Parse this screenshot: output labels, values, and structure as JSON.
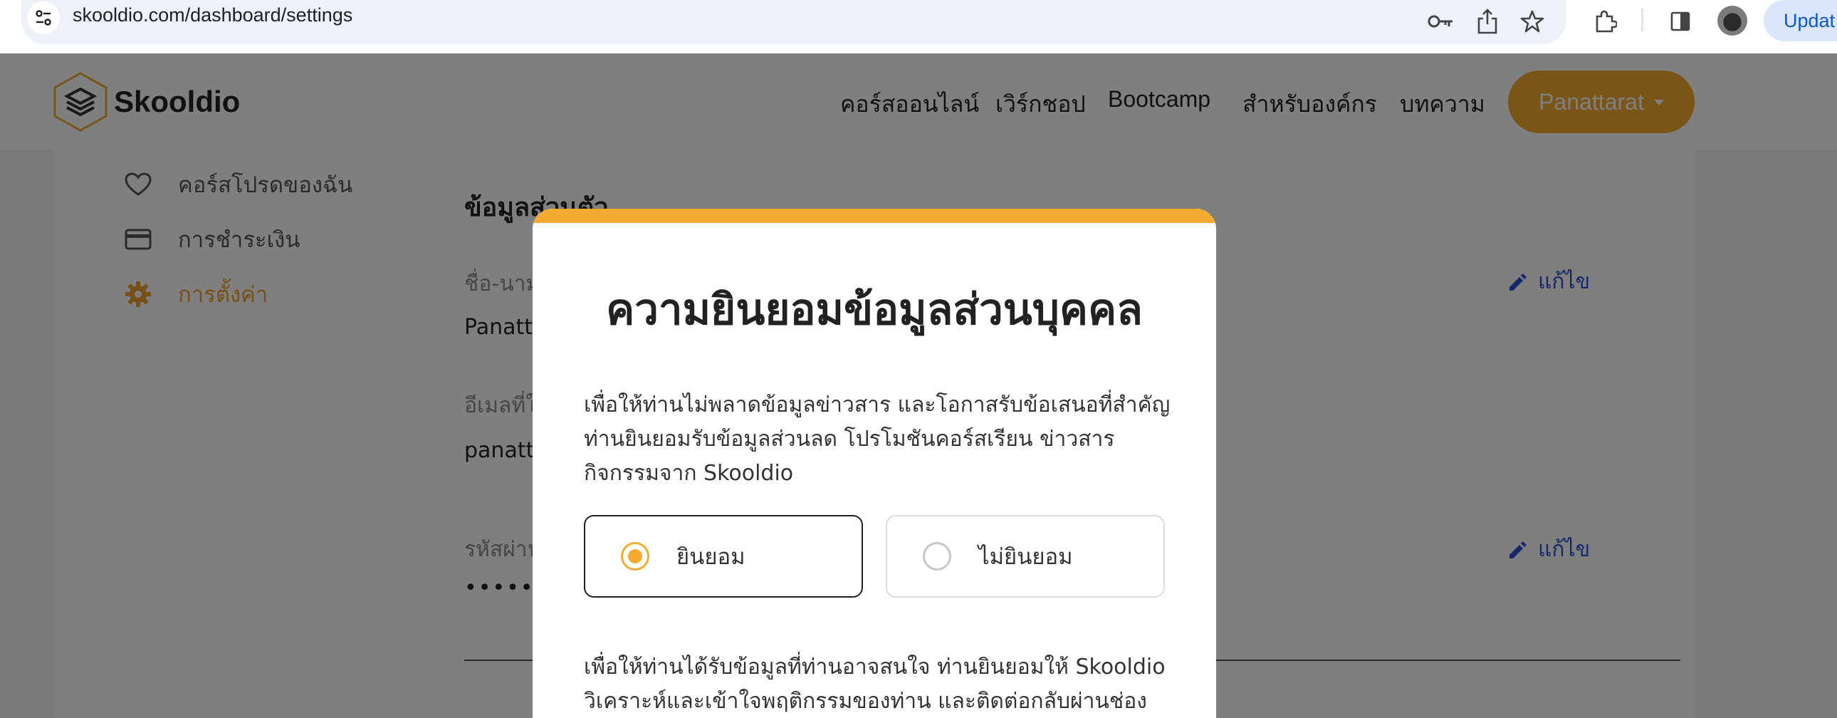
{
  "browser": {
    "url": "skooldio.com/dashboard/settings",
    "update_label": "Updat"
  },
  "header": {
    "logo_text": "Skooldio",
    "nav": [
      "คอร์สออนไลน์",
      "เวิร์กชอป",
      "Bootcamp",
      "สำหรับองค์กร",
      "บทความ"
    ],
    "user_label": "Panattarat",
    "accent_color": "#f3ac30"
  },
  "sidebar": {
    "items": [
      {
        "label": "คอร์สโปรดของฉัน",
        "icon": "heart-icon"
      },
      {
        "label": "การชำระเงิน",
        "icon": "credit-card-icon"
      },
      {
        "label": "การตั้งค่า",
        "icon": "gear-icon",
        "active": true
      }
    ]
  },
  "settings": {
    "section_title": "ข้อมูลส่วนตัว",
    "name_label": "ชื่อ-นาม",
    "name_value": "Panatt",
    "email_label": "อีเมลที่ใ",
    "email_value": "panatt",
    "password_label": "รหัสผ่าน",
    "password_value": "•••••••",
    "edit_label": "แก้ไข"
  },
  "modal": {
    "title": "ความยินยอมข้อมูลส่วนบุคคล",
    "paragraph1": [
      "เพื่อให้ท่านไม่พลาดข้อมูลข่าวสาร และโอกาสรับข้อเสนอที่สำคัญ",
      "ท่านยินยอมรับข้อมูลส่วนลด โปรโมชันคอร์สเรียน ข่าวสาร",
      "กิจกรรมจาก Skooldio"
    ],
    "options": [
      {
        "label": "ยินยอม",
        "selected": true
      },
      {
        "label": "ไม่ยินยอม",
        "selected": false
      }
    ],
    "paragraph2": [
      "เพื่อให้ท่านได้รับข้อมูลที่ท่านอาจสนใจ ท่านยินยอมให้ Skooldio",
      "วิเคราะห์และเข้าใจพฤติกรรมของท่าน และติดต่อกลับผ่านช่องทาง"
    ]
  }
}
